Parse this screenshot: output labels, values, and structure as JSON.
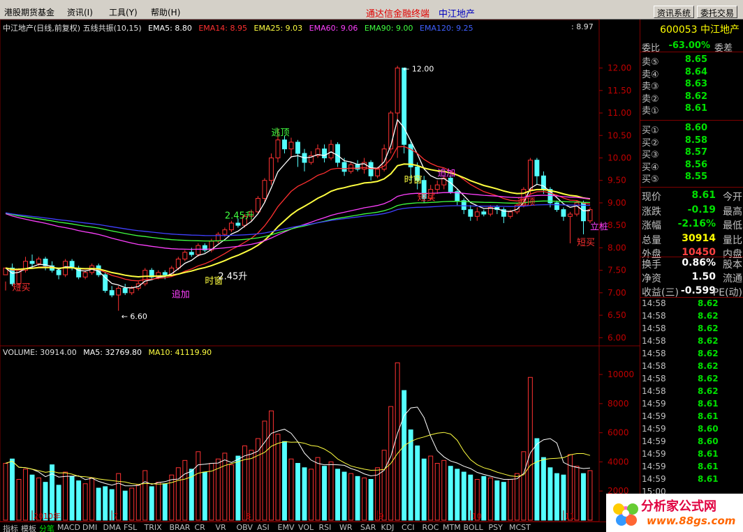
{
  "menu": {
    "items": [
      "港股期货基金",
      "资讯(I)",
      "工具(Y)",
      "帮助(H)"
    ],
    "center_title": "通达信金融终端",
    "center_stock": "中江地产",
    "buttons": [
      "资讯系统",
      "委托交易"
    ]
  },
  "indicators": {
    "main_title": "中江地产(日线,前复权) 五线共振(10,15)",
    "ema5": "EMA5: 8.80",
    "ema14": "EMA14: 8.95",
    "ema25": "EMA25: 9.03",
    "ema60": "EMA60: 9.06",
    "ema90": "EMA90: 9.00",
    "ema120": "EMA120: 9.25",
    "top_right_value": ": 8.97",
    "volume_title": "VOLUME: 30914.00",
    "vol_ma5": "MA5: 32769.80",
    "vol_ma10": "MA10: 41119.90"
  },
  "chart_data": {
    "type": "candlestick",
    "price_axis": [
      "12.00",
      "11.50",
      "11.00",
      "10.50",
      "10.00",
      "9.50",
      "9.00",
      "8.50",
      "8.00",
      "7.50",
      "7.00",
      "6.50",
      "6.00"
    ],
    "volume_axis": [
      "10000",
      "8000",
      "6000",
      "4000",
      "2000"
    ],
    "date_labels": [
      "2010年",
      "7",
      "8",
      "9",
      "10",
      "11"
    ],
    "annotations": {
      "high": "12.00",
      "low": "6.60",
      "signals": [
        "短买",
        "追加",
        "时窗",
        "逃顶",
        "2.45升",
        "立桩",
        "短买",
        "逃顶",
        "短买",
        "追加",
        "时窗",
        "2.45升"
      ]
    },
    "candles": [
      [
        7.4,
        7.55,
        7.25,
        7.05
      ],
      [
        7.55,
        7.2,
        7.65,
        7.15
      ],
      [
        7.2,
        7.5,
        7.55,
        7.1
      ],
      [
        7.5,
        7.7,
        7.8,
        7.45
      ],
      [
        7.7,
        7.65,
        7.85,
        7.55
      ],
      [
        7.65,
        7.75,
        7.8,
        7.6
      ],
      [
        7.75,
        7.6,
        7.8,
        7.5
      ],
      [
        7.6,
        7.5,
        7.7,
        7.45
      ],
      [
        7.5,
        7.4,
        7.55,
        7.3
      ],
      [
        7.4,
        7.7,
        7.75,
        7.35
      ],
      [
        7.7,
        7.55,
        7.75,
        7.5
      ],
      [
        7.55,
        7.35,
        7.6,
        7.3
      ],
      [
        7.35,
        7.45,
        7.5,
        7.3
      ],
      [
        7.45,
        7.6,
        7.65,
        7.4
      ],
      [
        7.6,
        7.4,
        7.65,
        7.35
      ],
      [
        7.4,
        7.05,
        7.45,
        7.0
      ],
      [
        7.05,
        6.95,
        7.15,
        6.9
      ],
      [
        6.95,
        7.1,
        7.15,
        6.6
      ],
      [
        7.1,
        7.0,
        7.2,
        6.95
      ],
      [
        7.0,
        7.1,
        7.15,
        6.95
      ],
      [
        7.1,
        7.2,
        7.25,
        7.05
      ],
      [
        7.2,
        7.5,
        7.55,
        7.15
      ],
      [
        7.5,
        7.35,
        7.55,
        7.3
      ],
      [
        7.35,
        7.45,
        7.5,
        7.3
      ],
      [
        7.45,
        7.4,
        7.5,
        7.3
      ],
      [
        7.4,
        7.55,
        7.6,
        7.35
      ],
      [
        7.55,
        7.75,
        7.8,
        7.5
      ],
      [
        7.75,
        7.9,
        7.95,
        7.7
      ],
      [
        7.9,
        7.85,
        8.0,
        7.8
      ],
      [
        7.85,
        8.05,
        8.1,
        7.8
      ],
      [
        8.05,
        7.95,
        8.1,
        7.9
      ],
      [
        7.95,
        8.15,
        8.2,
        7.9
      ],
      [
        8.15,
        8.3,
        8.35,
        8.1
      ],
      [
        8.3,
        8.4,
        8.45,
        8.25
      ],
      [
        8.4,
        8.55,
        8.6,
        8.35
      ],
      [
        8.55,
        8.5,
        8.65,
        8.45
      ],
      [
        8.5,
        8.7,
        8.75,
        8.45
      ],
      [
        8.7,
        8.8,
        8.85,
        8.6
      ],
      [
        8.8,
        9.1,
        9.15,
        8.75
      ],
      [
        9.1,
        9.5,
        9.55,
        9.0
      ],
      [
        9.5,
        10.0,
        10.1,
        9.4
      ],
      [
        10.0,
        10.4,
        10.65,
        9.9
      ],
      [
        10.4,
        10.2,
        10.5,
        10.1
      ],
      [
        10.2,
        10.35,
        10.45,
        10.0
      ],
      [
        10.35,
        10.1,
        10.4,
        9.8
      ],
      [
        10.1,
        9.9,
        10.2,
        9.7
      ],
      [
        9.9,
        10.05,
        10.15,
        9.85
      ],
      [
        10.05,
        10.2,
        10.3,
        10.0
      ],
      [
        10.2,
        10.0,
        10.3,
        9.9
      ],
      [
        10.0,
        10.3,
        10.4,
        9.95
      ],
      [
        10.3,
        9.9,
        10.35,
        9.8
      ],
      [
        9.9,
        9.7,
        10.0,
        9.6
      ],
      [
        9.7,
        9.85,
        9.9,
        9.65
      ],
      [
        9.85,
        9.75,
        9.95,
        9.7
      ],
      [
        9.75,
        9.9,
        10.0,
        9.65
      ],
      [
        9.9,
        9.6,
        9.95,
        9.5
      ],
      [
        9.6,
        9.75,
        9.8,
        9.55
      ],
      [
        9.75,
        10.2,
        10.3,
        9.7
      ],
      [
        10.2,
        11.0,
        11.05,
        10.1
      ],
      [
        11.0,
        12.0,
        12.05,
        10.0
      ],
      [
        12.0,
        10.3,
        12.0,
        10.1
      ],
      [
        10.3,
        9.8,
        10.4,
        9.5
      ],
      [
        9.8,
        9.5,
        9.9,
        9.3
      ],
      [
        9.5,
        9.1,
        9.6,
        9.0
      ],
      [
        9.1,
        9.3,
        9.4,
        9.05
      ],
      [
        9.3,
        9.4,
        9.5,
        9.2
      ],
      [
        9.4,
        9.55,
        9.6,
        9.3
      ],
      [
        9.55,
        9.25,
        9.6,
        9.2
      ],
      [
        9.25,
        9.05,
        9.3,
        8.95
      ],
      [
        9.05,
        8.85,
        9.1,
        8.75
      ],
      [
        8.85,
        8.7,
        8.95,
        8.6
      ],
      [
        8.7,
        8.8,
        8.9,
        8.6
      ],
      [
        8.8,
        8.75,
        8.85,
        8.7
      ],
      [
        8.75,
        8.9,
        8.95,
        8.7
      ],
      [
        8.9,
        8.85,
        8.95,
        8.75
      ],
      [
        8.85,
        8.7,
        8.9,
        8.55
      ],
      [
        8.7,
        8.8,
        8.85,
        8.65
      ],
      [
        8.8,
        8.95,
        9.0,
        8.75
      ],
      [
        8.95,
        9.3,
        9.35,
        8.9
      ],
      [
        9.3,
        9.95,
        10.0,
        9.2
      ],
      [
        9.95,
        9.6,
        10.0,
        9.4
      ],
      [
        9.6,
        9.3,
        9.7,
        9.2
      ],
      [
        9.3,
        9.0,
        9.35,
        8.9
      ],
      [
        9.0,
        8.85,
        9.05,
        8.8
      ],
      [
        8.85,
        8.7,
        8.9,
        8.6
      ],
      [
        8.7,
        8.75,
        8.8,
        8.1
      ],
      [
        8.75,
        9.0,
        9.05,
        8.7
      ],
      [
        9.0,
        8.6,
        9.05,
        8.3
      ],
      [
        8.6,
        8.85,
        8.9,
        8.55
      ]
    ],
    "volumes": [
      3900,
      4200,
      2800,
      3500,
      3100,
      2900,
      2600,
      3800,
      2400,
      3300,
      3000,
      2700,
      2500,
      2900,
      2200,
      2300,
      2100,
      3200,
      2000,
      2200,
      2400,
      3400,
      2300,
      2600,
      2500,
      3100,
      3600,
      4100,
      3500,
      4700,
      3300,
      3900,
      4200,
      4600,
      3800,
      4400,
      5100,
      4800,
      5600,
      6800,
      7500,
      5900,
      5400,
      4200,
      3900,
      3600,
      3500,
      4300,
      3700,
      4000,
      3500,
      3300,
      3200,
      3000,
      2900,
      2800,
      3600,
      4800,
      7800,
      10800,
      8900,
      6200,
      5100,
      4200,
      4400,
      3900,
      4100,
      3700,
      3500,
      3300,
      3100,
      2800,
      3000,
      2900,
      2700,
      2600,
      2800,
      3200,
      4700,
      9800,
      5600,
      4300,
      3600,
      3200,
      3100,
      4500,
      3700,
      3200,
      3400
    ],
    "ema_series": [
      {
        "name": "EMA5",
        "color": "#ffffff"
      },
      {
        "name": "EMA14",
        "color": "#ff3030"
      },
      {
        "name": "EMA25",
        "color": "#ffff40"
      },
      {
        "name": "EMA60",
        "color": "#ff40ff"
      },
      {
        "name": "EMA90",
        "color": "#40ff40"
      },
      {
        "name": "EMA120",
        "color": "#4040ff"
      }
    ]
  },
  "quote": {
    "code_name": "600053 中江地产",
    "weibi_label": "委比",
    "weibi_val": "-63.00%",
    "weicha_label": "委差",
    "sell": [
      {
        "label": "卖⑤",
        "price": "8.65"
      },
      {
        "label": "卖④",
        "price": "8.64"
      },
      {
        "label": "卖③",
        "price": "8.63"
      },
      {
        "label": "卖②",
        "price": "8.62"
      },
      {
        "label": "卖①",
        "price": "8.61"
      }
    ],
    "buy": [
      {
        "label": "买①",
        "price": "8.60"
      },
      {
        "label": "买②",
        "price": "8.58"
      },
      {
        "label": "买③",
        "price": "8.57"
      },
      {
        "label": "买④",
        "price": "8.56"
      },
      {
        "label": "买⑤",
        "price": "8.55"
      }
    ],
    "stats": [
      {
        "label": "现价",
        "val": "8.61",
        "label2": "今开",
        "color": "#00e000"
      },
      {
        "label": "涨跌",
        "val": "-0.19",
        "label2": "最高",
        "color": "#00e000"
      },
      {
        "label": "涨幅",
        "val": "-2.16%",
        "label2": "最低",
        "color": "#00e000"
      },
      {
        "label": "总量",
        "val": "30914",
        "label2": "量比",
        "color": "#ffff00"
      },
      {
        "label": "外盘",
        "val": "10450",
        "label2": "内盘",
        "color": "#ff4040"
      }
    ],
    "stats2": [
      {
        "label": "换手",
        "val": "0.86%",
        "label2": "股本"
      },
      {
        "label": "净资",
        "val": "1.50",
        "label2": "流通"
      },
      {
        "label": "收益(三)",
        "val": "-0.599",
        "label2": "PE(动)"
      }
    ],
    "ticks": [
      {
        "t": "14:58",
        "p": "8.62"
      },
      {
        "t": "14:58",
        "p": "8.62"
      },
      {
        "t": "14:58",
        "p": "8.62"
      },
      {
        "t": "14:58",
        "p": "8.62"
      },
      {
        "t": "14:58",
        "p": "8.62"
      },
      {
        "t": "14:58",
        "p": "8.62"
      },
      {
        "t": "14:58",
        "p": "8.62"
      },
      {
        "t": "14:58",
        "p": "8.62"
      },
      {
        "t": "14:59",
        "p": "8.61"
      },
      {
        "t": "14:59",
        "p": "8.61"
      },
      {
        "t": "14:59",
        "p": "8.60"
      },
      {
        "t": "14:59",
        "p": "8.60"
      },
      {
        "t": "14:59",
        "p": "8.61"
      },
      {
        "t": "14:59",
        "p": "8.61"
      },
      {
        "t": "14:59",
        "p": "8.61"
      },
      {
        "t": "15:00",
        "p": ""
      }
    ]
  },
  "bottom_tabs": [
    "指标",
    "模板",
    "分笔",
    "MACD",
    "DMI",
    "DMA",
    "FSL",
    "TRIX",
    "BRAR",
    "CR",
    "VR",
    "OBV",
    "ASI",
    "EMV",
    "VOL",
    "RSI",
    "WR",
    "SAR",
    "KDJ",
    "CCI",
    "ROC",
    "MTM",
    "BOLL",
    "PSY",
    "MCST"
  ],
  "watermark": {
    "title": "分析家公式网",
    "url": "www.88gs.com"
  }
}
